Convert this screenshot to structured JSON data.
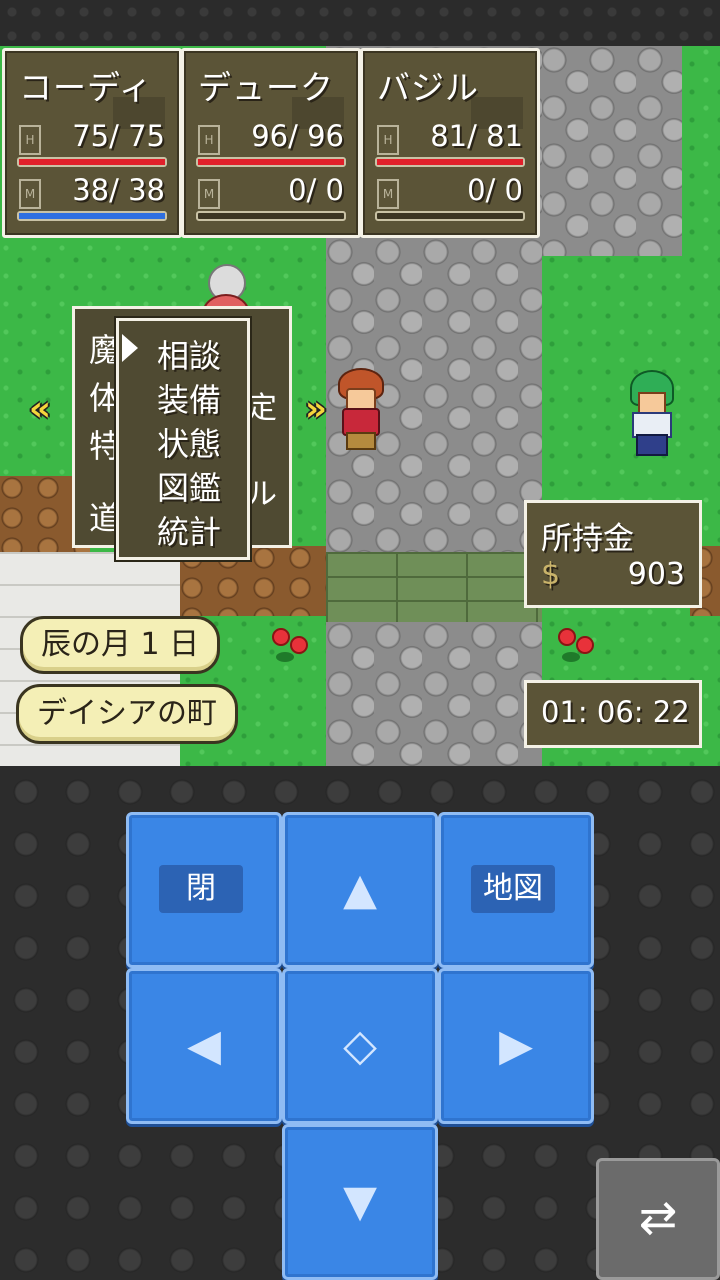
{
  "party": [
    {
      "name": "コーディ",
      "hp": "75/ 75",
      "mp": "38/ 38",
      "hp_fraction": 1.0,
      "mp_fraction": 1.0
    },
    {
      "name": "デューク",
      "hp": "96/ 96",
      "mp": "0/ 0",
      "hp_fraction": 1.0,
      "mp_fraction": 0.0
    },
    {
      "name": "バジル",
      "hp": "81/ 81",
      "mp": "0/ 0",
      "hp_fraction": 1.0,
      "mp_fraction": 0.0
    }
  ],
  "back_menu": {
    "items": [
      "魔",
      "体",
      "特",
      "道"
    ],
    "right_fragments": [
      "定",
      "ル"
    ]
  },
  "command_menu": {
    "items": [
      "相談",
      "装備",
      "状態",
      "図鑑",
      "統計"
    ]
  },
  "money": {
    "label": "所持金",
    "currency_symbol": "$",
    "amount": "903"
  },
  "clock": "01: 06: 22",
  "date": "辰の月 1 日",
  "location": "デイシアの町",
  "controls": {
    "close_label": "閉",
    "map_label": "地図",
    "up_glyph": "▲",
    "down_glyph": "▼",
    "left_glyph": "◀",
    "right_glyph": "▶",
    "center_glyph": "◇",
    "swap_glyph": "⇄"
  },
  "colors": {
    "hp_bar": "#e0202a",
    "mp_bar": "#2f6fe0",
    "panel": "#5b5437",
    "button": "#3a86e6"
  }
}
